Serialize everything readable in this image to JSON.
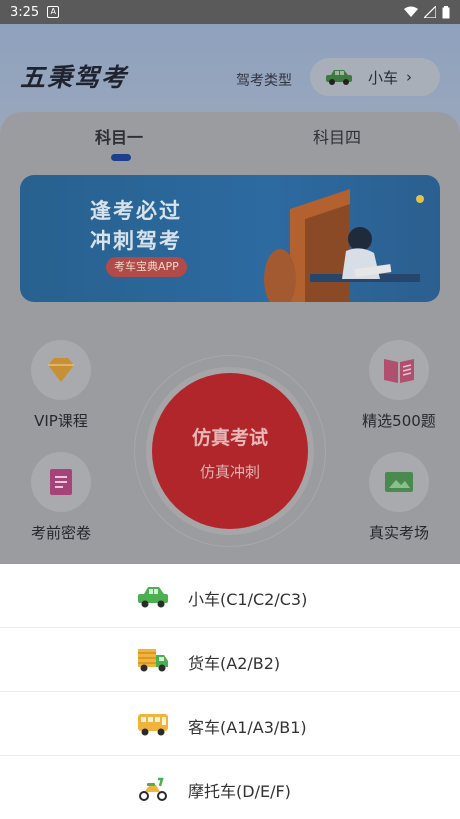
{
  "status_bar": {
    "time": "3:25",
    "notif_icon": "A"
  },
  "header": {
    "logo": "五秉驾考",
    "type_label": "驾考类型",
    "type_value": "小车",
    "chevron": "›"
  },
  "tabs": [
    {
      "label": "科目一",
      "active": true
    },
    {
      "label": "科目四",
      "active": false
    }
  ],
  "banner": {
    "line1": "逢考必过",
    "line2": "冲刺驾考",
    "tag": "考车宝典APP"
  },
  "features": {
    "vip": "VIP课程",
    "selected": "精选500题",
    "secret": "考前密卷",
    "real": "真实考场"
  },
  "exam": {
    "title": "仿真考试",
    "subtitle": "仿真冲刺"
  },
  "sheet": {
    "items": [
      {
        "label": "小车(C1/C2/C3)",
        "icon": "car-icon",
        "color": "#4caf50"
      },
      {
        "label": "货车(A2/B2)",
        "icon": "truck-icon",
        "color": "#4caf50"
      },
      {
        "label": "客车(A1/A3/B1)",
        "icon": "bus-icon",
        "color": "#f0b43c"
      },
      {
        "label": "摩托车(D/E/F)",
        "icon": "motorcycle-icon",
        "color": "#f0b43c"
      }
    ]
  }
}
